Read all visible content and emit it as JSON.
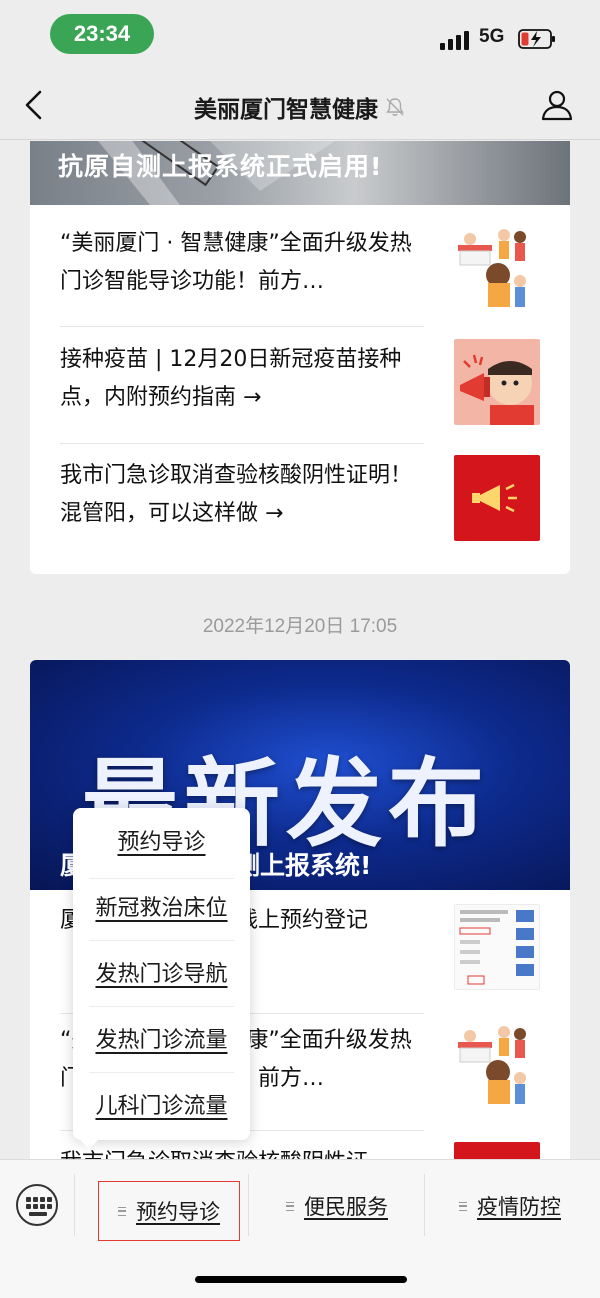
{
  "status_bar": {
    "time": "23:34",
    "network": "5G",
    "time_pill_color": "#3aa655"
  },
  "nav": {
    "title": "美丽厦门智慧健康",
    "back_icon": "chevron-left-icon",
    "mute_icon": "bell-off-icon",
    "profile_icon": "person-icon"
  },
  "card1": {
    "cover_title": "抗原自测上报系统正式启用!",
    "items": [
      {
        "text": "“美丽厦门 · 智慧健康”全面升级发热门诊智能导诊功能！前方…",
        "thumb": "clinic-illustration"
      },
      {
        "text": "接种疫苗 | 12月20日新冠疫苗接种点，内附预约指南 →",
        "thumb": "megaphone-cartoon"
      },
      {
        "text": "我市门急诊取消查验核酸阴性证明！混管阳，可以这样做 →",
        "thumb": "red-megaphone"
      }
    ]
  },
  "timestamp": "2022年12月20日 17:05",
  "card2": {
    "cover_big_text": "最新发布",
    "cover_title": "厦门上线抗原自测上报系统!",
    "items": [
      {
        "text": "厦门上线疫情物资线上预约登记",
        "thumb": "app-screenshot"
      },
      {
        "text": "“美丽厦门 · 智慧健康”全面升级发热门诊智能导诊功能！前方…",
        "thumb": "clinic-illustration"
      },
      {
        "text": "我市门急诊取消查验核酸阴性证",
        "thumb": "red-banner"
      }
    ]
  },
  "popup_menu": {
    "items": [
      "预约导诊",
      "新冠救治床位",
      "发热门诊导航",
      "发热门诊流量",
      "儿科门诊流量"
    ]
  },
  "bottom_menu": {
    "keyboard_icon": "keyboard-icon",
    "tabs": [
      "预约导诊",
      "便民服务",
      "疫情防控"
    ],
    "highlight_color": "#e23b32"
  }
}
